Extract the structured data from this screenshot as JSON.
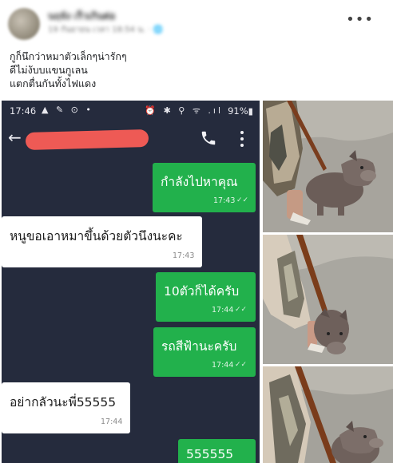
{
  "post": {
    "author_name": "นฤจัง เร็วเกินต่อ",
    "meta": "19 กันยายน เวลา 18:54 น. · 🌐",
    "more_icon": "ellipsis-icon",
    "caption_lines": [
      "กูก็นึกว่าหมาตัวเล็กๆน่ารักๆ",
      "ดีไม่งับบแขนกูเลน",
      "แตกตื่นกันทั้งไฟแดง"
    ]
  },
  "phone": {
    "status_time": "17:46",
    "status_left_icons": "▲ ✎ ⊙ •",
    "status_right_icons": "⏰ ✱ ⚲ ᯤ .ıl",
    "battery": "91%",
    "back_icon": "back-arrow-icon",
    "call_icon": "phone-icon",
    "menu_icon": "kebab-menu-icon"
  },
  "messages": [
    {
      "side": "out",
      "text": "กำลังไปหาคุณ",
      "time": "17:43"
    },
    {
      "side": "in",
      "text": "หนูขอเอาหมาขึ้นด้วยตัวนึงนะคะ",
      "time": "17:43"
    },
    {
      "side": "out",
      "text": "10ตัวก็ได้ครับ",
      "time": "17:44"
    },
    {
      "side": "out",
      "text": "รถสีฟ้านะครับ",
      "time": "17:44"
    },
    {
      "side": "in",
      "text": "อย่ากลัวนะพี่55555",
      "time": "17:44"
    },
    {
      "side": "out",
      "text": "555555",
      "time": ""
    }
  ],
  "photos": [
    "dog-photo-1",
    "dog-photo-2",
    "dog-photo-3"
  ],
  "colors": {
    "chat_bg": "#252b3d",
    "outgoing_bubble": "#22b14c",
    "incoming_bubble": "#ffffff",
    "redaction": "#ee5a55"
  }
}
